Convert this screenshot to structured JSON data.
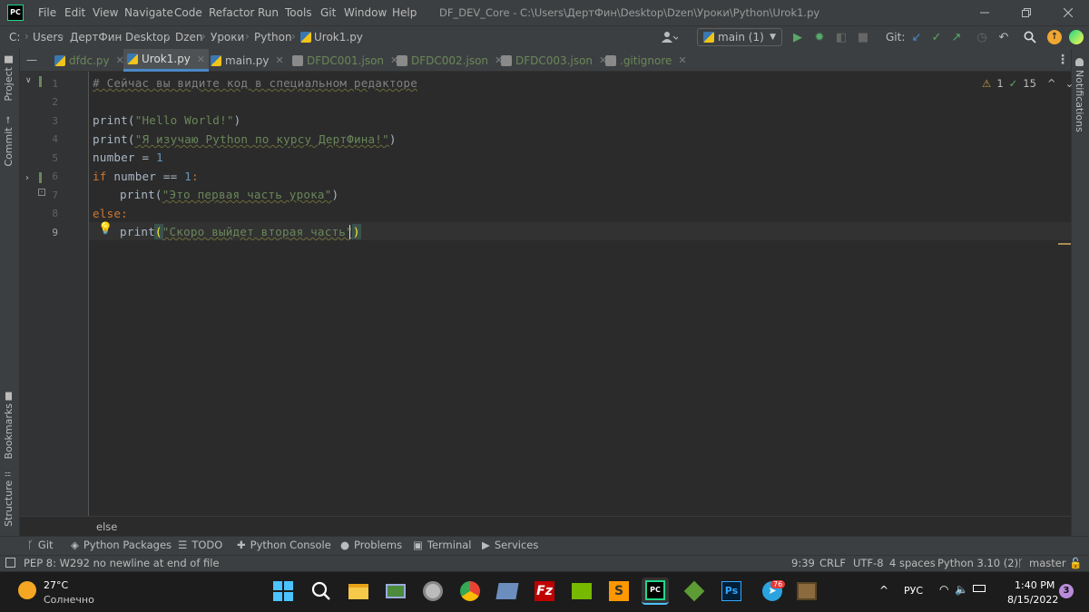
{
  "app": {
    "logo": "PC",
    "window_title": "DF_DEV_Core - C:\\Users\\ДертФин\\Desktop\\Dzen\\Уроки\\Python\\Urok1.py",
    "menu": [
      "File",
      "Edit",
      "View",
      "Navigate",
      "Code",
      "Refactor",
      "Run",
      "Tools",
      "Git",
      "Window",
      "Help"
    ]
  },
  "navbar": {
    "breadcrumbs": [
      "C:",
      "Users",
      "ДертФин",
      "Desktop",
      "Dzen",
      "Уроки",
      "Python",
      "Urok1.py"
    ],
    "branch": "main (1)",
    "git_label": "Git:"
  },
  "side_tabs": {
    "project": "Project",
    "commit": "Commit",
    "bookmarks": "Bookmarks",
    "structure": "Structure",
    "notifications": "Notifications"
  },
  "tabs": [
    {
      "label": "dfdc.py",
      "color": "#6a8759"
    },
    {
      "label": "Urok1.py",
      "color": "#bbbbbb",
      "active": true
    },
    {
      "label": "main.py",
      "color": "#bbbbbb"
    },
    {
      "label": "DFDC001.json",
      "color": "#6a8759"
    },
    {
      "label": "DFDC002.json",
      "color": "#6a8759"
    },
    {
      "label": "DFDC003.json",
      "color": "#6a8759"
    },
    {
      "label": ".gitignore",
      "color": "#6a8759"
    }
  ],
  "inspections": {
    "warnings": "1",
    "weak_warnings": "15"
  },
  "code": {
    "line_numbers": [
      "1",
      "2",
      "3",
      "4",
      "5",
      "6",
      "7",
      "8",
      "9"
    ],
    "l1": "# Сейчас вы видите код в специальном редакторе",
    "l3_fn": "print(",
    "l3_str": "\"Hello World!\"",
    "l3_end": ")",
    "l4_fn": "print(",
    "l4_str": "\"Я изучаю Python по курсу ДертФина!\"",
    "l4_end": ")",
    "l5_a": "number = ",
    "l5_num": "1",
    "l6_kw": "if",
    "l6_mid": " number == ",
    "l6_num": "1",
    "l6_end": ":",
    "l7_fn": "print(",
    "l7_str": "\"Это первая часть урока\"",
    "l7_end": ")",
    "l8_kw": "else",
    "l8_end": ":",
    "l9_fn": "print",
    "l9_open": "(",
    "l9_str": "\"Скоро выйдет вторая часть\"",
    "l9_close": ")"
  },
  "editor_breadcrumb": "else",
  "tool_windows": [
    "Git",
    "Python Packages",
    "TODO",
    "Python Console",
    "Problems",
    "Terminal",
    "Services"
  ],
  "status": {
    "message": "PEP 8: W292 no newline at end of file",
    "position": "9:39",
    "line_sep": "CRLF",
    "encoding": "UTF-8",
    "indent": "4 spaces",
    "interpreter": "Python 3.10 (2)",
    "vcs_branch": "master"
  },
  "taskbar": {
    "weather_temp": "27°C",
    "weather_desc": "Солнечно",
    "lang": "РУС",
    "time": "1:40 PM",
    "date": "8/15/2022",
    "notification_count": "3",
    "telegram_badge": "76"
  },
  "colors": {
    "accent": "#4a88c7",
    "keyword": "#cc7832",
    "string": "#6a8759",
    "number": "#6897bb",
    "comment": "#808080"
  }
}
